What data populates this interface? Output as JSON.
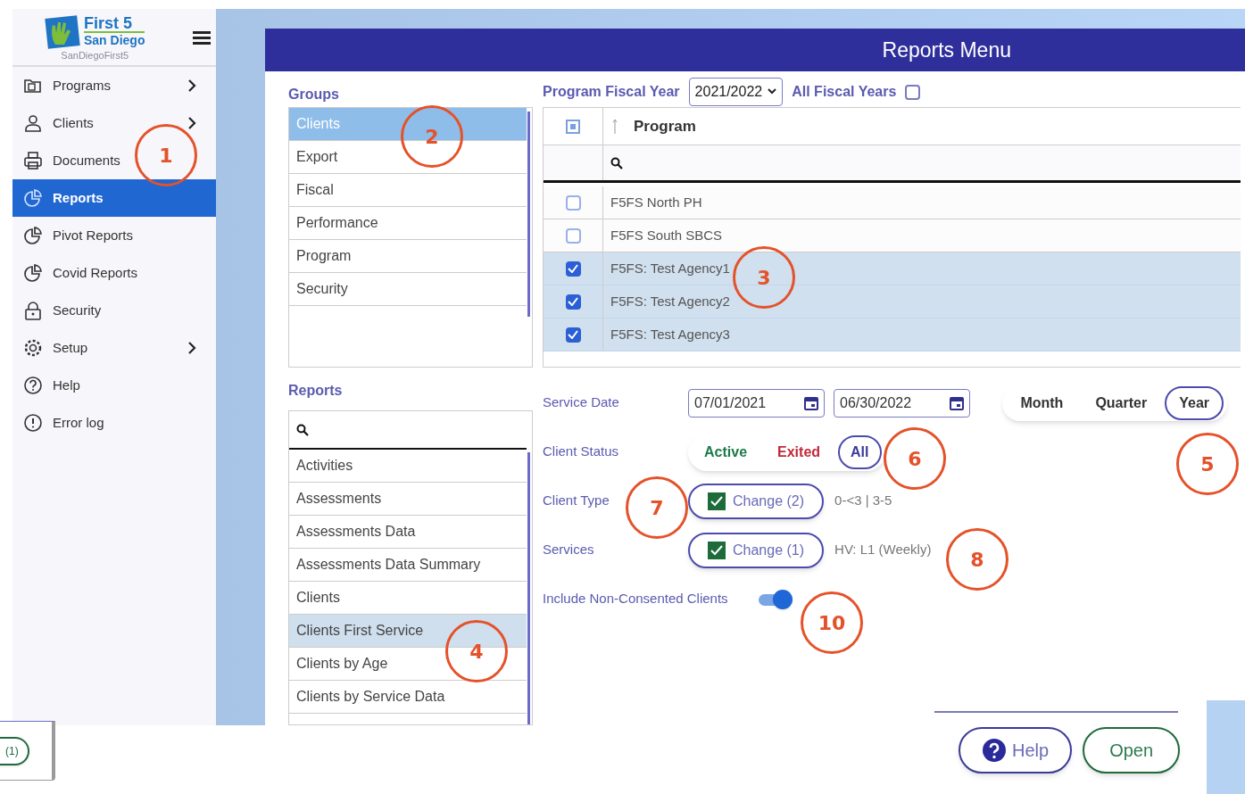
{
  "sidebar": {
    "logo": {
      "title": "First 5",
      "subtitle": "San Diego",
      "caption": "SanDiegoFirst5"
    },
    "items": [
      {
        "label": "Programs",
        "kind": "folder",
        "submenu": true,
        "selected": false
      },
      {
        "label": "Clients",
        "kind": "person",
        "submenu": true,
        "selected": false
      },
      {
        "label": "Documents",
        "kind": "printer",
        "submenu": false,
        "selected": false
      },
      {
        "label": "Reports",
        "kind": "pie",
        "submenu": false,
        "selected": true
      },
      {
        "label": "Pivot Reports",
        "kind": "pie",
        "submenu": false,
        "selected": false
      },
      {
        "label": "Covid Reports",
        "kind": "pie",
        "submenu": false,
        "selected": false
      },
      {
        "label": "Security",
        "kind": "lock",
        "submenu": false,
        "selected": false
      },
      {
        "label": "Setup",
        "kind": "gear",
        "submenu": true,
        "selected": false
      },
      {
        "label": "Help",
        "kind": "question",
        "submenu": false,
        "selected": false
      },
      {
        "label": "Error log",
        "kind": "alert",
        "submenu": false,
        "selected": false
      }
    ]
  },
  "panel": {
    "title": "Reports Menu"
  },
  "groups": {
    "label": "Groups",
    "items": [
      {
        "label": "Clients",
        "selected": true
      },
      {
        "label": "Export",
        "selected": false
      },
      {
        "label": "Fiscal",
        "selected": false
      },
      {
        "label": "Performance",
        "selected": false
      },
      {
        "label": "Program",
        "selected": false
      },
      {
        "label": "Security",
        "selected": false
      }
    ]
  },
  "reports": {
    "label": "Reports",
    "items": [
      {
        "label": "Activities",
        "selected": false
      },
      {
        "label": "Assessments",
        "selected": false
      },
      {
        "label": "Assessments Data",
        "selected": false
      },
      {
        "label": "Assessments Data Summary",
        "selected": false
      },
      {
        "label": "Clients",
        "selected": false
      },
      {
        "label": "Clients First Service",
        "selected": true
      },
      {
        "label": "Clients by Age",
        "selected": false
      },
      {
        "label": "Clients by Service Data",
        "selected": false
      }
    ]
  },
  "fiscal": {
    "label": "Program Fiscal Year",
    "value": "2021/2022",
    "all_label": "All Fiscal Years",
    "all_checked": false
  },
  "programs_table": {
    "select_all_partial": true,
    "column": "Program",
    "rows": [
      {
        "name": "F5FS North PH",
        "checked": false
      },
      {
        "name": "F5FS South SBCS",
        "checked": false
      },
      {
        "name": "F5FS: Test Agency1",
        "checked": true
      },
      {
        "name": "F5FS: Test Agency2",
        "checked": true
      },
      {
        "name": "F5FS: Test Agency3",
        "checked": true
      }
    ]
  },
  "service_date": {
    "label": "Service Date",
    "from": "07/01/2021",
    "to": "06/30/2022",
    "periods": [
      {
        "label": "Month",
        "selected": false
      },
      {
        "label": "Quarter",
        "selected": false
      },
      {
        "label": "Year",
        "selected": true
      }
    ]
  },
  "client_status": {
    "label": "Client Status",
    "options": [
      {
        "label": "Active",
        "color": "#1e7a4a",
        "selected": false
      },
      {
        "label": "Exited",
        "color": "#c0283a",
        "selected": false
      },
      {
        "label": "All",
        "color": "#3b3b9a",
        "selected": true
      }
    ]
  },
  "client_type": {
    "label": "Client Type",
    "button": "Change (2)",
    "checked": true,
    "summary": "0-<3 | 3-5"
  },
  "services": {
    "label": "Services",
    "button": "Change (1)",
    "checked": true,
    "summary": "HV: L1 (Weekly)"
  },
  "non_consented": {
    "label": "Include Non-Consented Clients",
    "on": true
  },
  "footer": {
    "buttons": [
      {
        "label": "Help",
        "kind": "help"
      },
      {
        "label": "Open",
        "kind": "open"
      }
    ]
  },
  "fragment": {
    "button": "(1)"
  },
  "callouts": [
    "1",
    "2",
    "3",
    "4",
    "5",
    "6",
    "7",
    "8",
    "10"
  ]
}
